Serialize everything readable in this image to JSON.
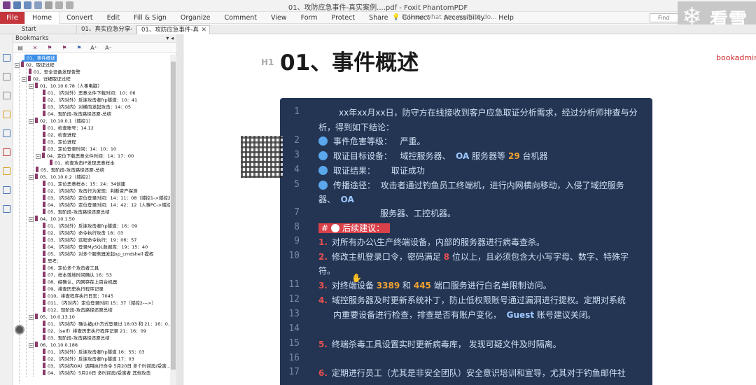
{
  "window": {
    "title": "01、攻防应急事件-真实案例....pdf - Foxit PhantomPDF"
  },
  "menu": {
    "file": "File",
    "items": [
      "Home",
      "Convert",
      "Edit",
      "Fill & Sign",
      "Organize",
      "Comment",
      "View",
      "Form",
      "Protect",
      "Share",
      "Connect",
      "Accessibility",
      "Help"
    ],
    "tell_me": "Tell me what you want to do...",
    "find_placeholder": "Find"
  },
  "logo": {
    "text": "看雪"
  },
  "tabs": [
    {
      "label": "Start"
    },
    {
      "label": "01、真实应急分享-完..."
    },
    {
      "label": "01、攻防应急事件-真实..."
    }
  ],
  "bookmarks": {
    "title": "Bookmarks",
    "items": [
      {
        "text": "01、事件概述",
        "selected": true
      },
      {
        "text": "02、取证过程"
      },
      {
        "text": "01、安全设备发现告警"
      },
      {
        "text": "02、详细取证过程"
      },
      {
        "text": "01、10.10.0.78（人事电脑）"
      },
      {
        "text": "01、（内对外）恶意文件下载时间：10：06"
      },
      {
        "text": "02、（内对外）反连攻击者frp隧道：10：41"
      },
      {
        "text": "03、（内对内）对横向发起攻击：14：05"
      },
      {
        "text": "04、现阶段-攻击路径还原-总结"
      },
      {
        "text": "02、10.10.0.1（域控1）"
      },
      {
        "text": "01、检查账号：14.12"
      },
      {
        "text": "02、检查进程"
      },
      {
        "text": "03、定位进程"
      },
      {
        "text": "03、定位登录时间：14：10：10"
      },
      {
        "text": "04、定位下载恶意文件时间：14：17：00"
      },
      {
        "text": "01、检查攻击IP发现恶意样本"
      },
      {
        "text": "05、现阶段-攻击路径还原-总结"
      },
      {
        "text": "03、10.10.0.2（域控2）"
      },
      {
        "text": "01、定位恶意样本：15：24：34创建"
      },
      {
        "text": "02、（内对内）攻击行为发现：判断资产探测"
      },
      {
        "text": "03、（内对内）定位登录时间：14：11：08（域控1->域控2）"
      },
      {
        "text": "04、（内对内）定位登录时间：14：42：12（人事PC->域控2）"
      },
      {
        "text": "05、现阶段-攻击路径还原总结"
      },
      {
        "text": "04、10.10.1.50"
      },
      {
        "text": "01、（内对外）反连攻击者frp隧道：16：09"
      },
      {
        "text": "02、（内对内）命令执行攻击 18：03"
      },
      {
        "text": "03、（内对内）远程命令执行：19：06：57"
      },
      {
        "text": "04、（内对内）登录MySQL数据库：19：15：40"
      },
      {
        "text": "05、（内对内）对多个服务器发起xp_cmdshell 提权"
      },
      {
        "text": "思考："
      },
      {
        "text": "06、定位多个攻击者工具"
      },
      {
        "text": "07、样本落地时间确认 16：53"
      },
      {
        "text": "08、经确认，内网存在上百台机器"
      },
      {
        "text": "09、排查历史执行程序记录"
      },
      {
        "text": "010、排查程序执行日志：7045"
      },
      {
        "text": "011、（内对内）定位登录时间 15：37（域控2--->）"
      },
      {
        "text": "012、现阶段-攻击路径还原总结"
      },
      {
        "text": "05、10.0.13.10"
      },
      {
        "text": "01、（内对内）确认被pth方式登录过 18:03 和 21：16：0..."
      },
      {
        "text": "02、（self）排查历史执行程序记录 21：16：09"
      },
      {
        "text": "03、现阶段-攻击路径还原总结"
      },
      {
        "text": "06、10.10.0.188"
      },
      {
        "text": "01、（内对外）反连攻击者frp隧道 16：55：03"
      },
      {
        "text": "02、（内对外）反连攻击者frp隧道 17：03"
      },
      {
        "text": "03、（内对内OA）调用执行命令 5月20日 多个时间段/受害..."
      },
      {
        "text": "04、（内对内）5月20日 多时间段/受害者 其他攻击"
      }
    ]
  },
  "page": {
    "h1_tag": "H1",
    "title": "01、事件概述",
    "author": "bookadmin"
  },
  "code_lines": [
    {
      "n": "1",
      "text": "xx年xx月xx日，防守方在线接收到客户应急取证分析需求，经过分析师排查与分"
    },
    {
      "n": "",
      "text": "析，得到如下结论："
    },
    {
      "n": "2",
      "label": "事件危害等级：",
      "value": "严重。"
    },
    {
      "n": "3",
      "label": "取证目标设备：",
      "value_a": "域控服务器、",
      "value_b": "OA",
      "value_c": "服务器等",
      "count": "29",
      "value_d": "台机器"
    },
    {
      "n": "4",
      "label": "取证结果：",
      "value": "取证成功"
    },
    {
      "n": "5",
      "label": "传播途径：",
      "value": "攻击者通过钓鱼员工终端机，进行内网横向移动，入侵了域控服务"
    },
    {
      "n": "",
      "text_a": "器、",
      "text_b": "OA"
    },
    {
      "n": "7",
      "text": "服务器、工控机器。"
    },
    {
      "n": "8",
      "prefix": "#",
      "text": "后续建议："
    },
    {
      "n": "9",
      "onum": "1.",
      "text": "对所有办公\\生产终端设备，内部的服务器进行病毒查杀。"
    },
    {
      "n": "10",
      "onum": "2.",
      "text_a": "修改主机登录口令，密码满足",
      "count": "8",
      "text_b": "位以上，且必须包含大小写字母、数字、特殊字"
    },
    {
      "n": "",
      "text": "符。"
    },
    {
      "n": "11",
      "onum": "3.",
      "text_a": "对终端设备",
      "p1": "3389",
      "text_b": "和",
      "p2": "445",
      "text_c": "端口服务进行白名单限制访问。"
    },
    {
      "n": "12",
      "onum": "4.",
      "text": "域控服务器及时更新系统补丁，防止低权限账号通过漏洞进行提权。定期对系统"
    },
    {
      "n": "13",
      "text_a": "内重要设备进行检查，排查是否有账户变化，",
      "kw": "Guest",
      "text_b": "账号建议关闭。"
    },
    {
      "n": "14",
      "text": ""
    },
    {
      "n": "15",
      "onum": "5.",
      "text": "终端杀毒工具设置实时更新病毒库，   发现可疑文件及时隔离。"
    },
    {
      "n": "16",
      "text": ""
    },
    {
      "n": "17",
      "onum": "6.",
      "text": "定期进行员工（尤其是非安全团队）安全意识培训和宣导，尤其对于钓鱼邮件社"
    }
  ],
  "colors": {
    "accent": "#c4363c",
    "code_bg": "#233553",
    "highlight": "#d9404a",
    "selected": "#3c8ee6",
    "number": "#f0a030"
  }
}
